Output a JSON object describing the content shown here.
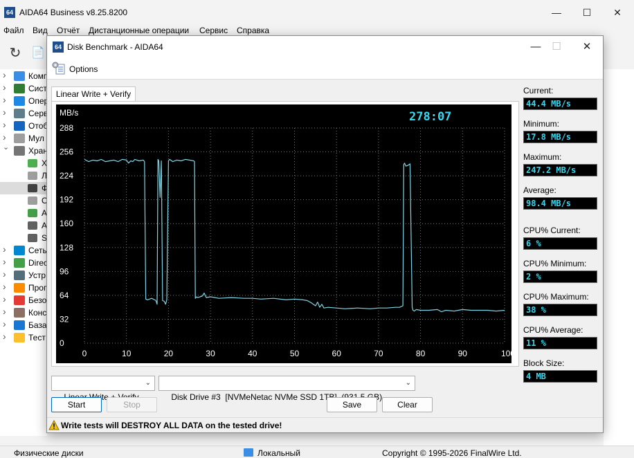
{
  "main_window": {
    "title": "AIDA64 Business v8.25.8200",
    "icon_text": "64",
    "controls": [
      "minimize-icon",
      "maximize-icon",
      "close-icon"
    ]
  },
  "menu": [
    "Файл",
    "Вид",
    "Отчёт",
    "Дистанционные операции",
    "Сервис",
    "Справка"
  ],
  "tree": {
    "items": [
      {
        "label": "Комп",
        "icon": "computer-icon",
        "color": "#3a8ee6",
        "expanded": false
      },
      {
        "label": "Сист",
        "icon": "motherboard-icon",
        "color": "#2e7d32",
        "expanded": false
      },
      {
        "label": "Опер",
        "icon": "windows-icon",
        "color": "#1e88e5",
        "expanded": false
      },
      {
        "label": "Серв",
        "icon": "server-icon",
        "color": "#607d8b",
        "expanded": false
      },
      {
        "label": "Отоб",
        "icon": "display-icon",
        "color": "#1565c0",
        "expanded": false
      },
      {
        "label": "Мул",
        "icon": "speaker-icon",
        "color": "#9e9e9e",
        "expanded": false
      },
      {
        "label": "Хран",
        "icon": "storage-icon",
        "color": "#757575",
        "expanded": true
      },
      {
        "label": "Х",
        "icon": "drive-icon",
        "color": "#4caf50",
        "sub": true
      },
      {
        "label": "Л",
        "icon": "disk-icon",
        "color": "#9e9e9e",
        "sub": true
      },
      {
        "label": "Ф",
        "icon": "physical-disk-icon",
        "color": "#424242",
        "sub": true,
        "selected": true
      },
      {
        "label": "О",
        "icon": "optical-icon",
        "color": "#9e9e9e",
        "sub": true
      },
      {
        "label": "А",
        "icon": "ata-icon",
        "color": "#43a047",
        "sub": true
      },
      {
        "label": "А",
        "icon": "smart-icon",
        "color": "#616161",
        "sub": true
      },
      {
        "label": "S",
        "icon": "smart-drive-icon",
        "color": "#616161",
        "sub": true
      },
      {
        "label": "Сеть",
        "icon": "network-icon",
        "color": "#0288d1",
        "expanded": false
      },
      {
        "label": "Direc",
        "icon": "directx-icon",
        "color": "#43a047",
        "expanded": false
      },
      {
        "label": "Устр",
        "icon": "devices-icon",
        "color": "#546e7a",
        "expanded": false
      },
      {
        "label": "Прог",
        "icon": "programs-icon",
        "color": "#fb8c00",
        "expanded": false
      },
      {
        "label": "Безо",
        "icon": "security-icon",
        "color": "#e53935",
        "expanded": false
      },
      {
        "label": "Конс",
        "icon": "config-icon",
        "color": "#8d6e63",
        "expanded": false
      },
      {
        "label": "База",
        "icon": "database-icon",
        "color": "#1976d2",
        "expanded": false
      },
      {
        "label": "Тест",
        "icon": "benchmark-icon",
        "color": "#fbc02d",
        "expanded": false
      }
    ]
  },
  "statusbar": {
    "left": "Физические диски",
    "middle": "Локальный",
    "right": "Copyright © 1995-2026 FinalWire Ltd."
  },
  "dialog": {
    "title": "Disk Benchmark - AIDA64",
    "icon_text": "64",
    "options_label": "Options",
    "tab_label": "Linear Write + Verify",
    "test_select": "Linear Write + Verify",
    "drive_select": "Disk Drive #3  [NVMeNetac NVMe SSD 1TB]  (931.5 GB)",
    "buttons": {
      "start": "Start",
      "stop": "Stop",
      "save": "Save",
      "clear": "Clear"
    },
    "warning": "Write tests will DESTROY ALL DATA on the tested drive!",
    "stats": [
      {
        "label": "Current:",
        "value": "44.4 MB/s"
      },
      {
        "label": "Minimum:",
        "value": "17.8 MB/s"
      },
      {
        "label": "Maximum:",
        "value": "247.2 MB/s"
      },
      {
        "label": "Average:",
        "value": "98.4 MB/s"
      },
      {
        "label": "CPU% Current:",
        "value": "6 %"
      },
      {
        "label": "CPU% Minimum:",
        "value": "2 %"
      },
      {
        "label": "CPU% Maximum:",
        "value": "38 %"
      },
      {
        "label": "CPU% Average:",
        "value": "11 %"
      },
      {
        "label": "Block Size:",
        "value": "4 MB"
      }
    ]
  },
  "chart_data": {
    "type": "line",
    "timer": "278:07",
    "ylabel": "MB/s",
    "ylim": [
      0,
      288
    ],
    "xlim": [
      0,
      100
    ],
    "y_ticks": [
      "288",
      "256",
      "224",
      "192",
      "160",
      "128",
      "96",
      "64",
      "32",
      "0"
    ],
    "x_ticks": [
      "0",
      "10",
      "20",
      "30",
      "40",
      "50",
      "60",
      "70",
      "80",
      "90",
      "100 %"
    ],
    "grid": true,
    "line_color": "#7fd6e6",
    "series": [
      {
        "x": [
          0,
          1,
          2,
          3,
          4,
          5,
          6,
          7,
          8,
          9,
          10,
          10.5,
          11,
          11.5,
          12,
          13,
          14,
          14.3,
          14.6,
          15,
          16,
          17,
          17.3,
          17.5,
          17.7,
          18,
          18.3,
          18.6,
          19,
          19.3,
          19.6,
          20,
          20.3,
          21,
          22,
          23,
          24,
          25,
          26,
          26.2,
          26.4,
          26.7,
          27,
          28,
          28.5,
          29,
          30,
          32,
          35,
          38,
          40,
          42,
          45,
          48,
          50,
          52,
          53,
          54,
          55,
          55.5,
          56,
          56.5,
          57,
          58,
          60,
          62,
          65,
          68,
          70,
          72,
          74,
          75,
          75.8,
          76,
          76.2,
          76.5,
          77,
          77.5,
          78,
          78.2,
          78.5,
          79,
          80,
          82,
          84,
          85,
          86,
          88,
          90,
          92,
          94,
          96,
          98,
          100
        ],
        "y": [
          246,
          243,
          245,
          244,
          246,
          243,
          244,
          245,
          243,
          246,
          245,
          241,
          244,
          243,
          246,
          244,
          245,
          243,
          59,
          58,
          60,
          57,
          52,
          246,
          244,
          195,
          244,
          57,
          56,
          52,
          58,
          244,
          246,
          243,
          245,
          244,
          246,
          245,
          244,
          243,
          60,
          62,
          61,
          63,
          67,
          61,
          62,
          60,
          61,
          60,
          60,
          59,
          60,
          58,
          59,
          58,
          57,
          54,
          50,
          55,
          48,
          52,
          47,
          48,
          47,
          46,
          47,
          46,
          47,
          47,
          48,
          48,
          50,
          239,
          241,
          237,
          238,
          240,
          48,
          44,
          43,
          45,
          44,
          44,
          45,
          42,
          44,
          43,
          45,
          44,
          44,
          44,
          43,
          44
        ]
      }
    ]
  }
}
